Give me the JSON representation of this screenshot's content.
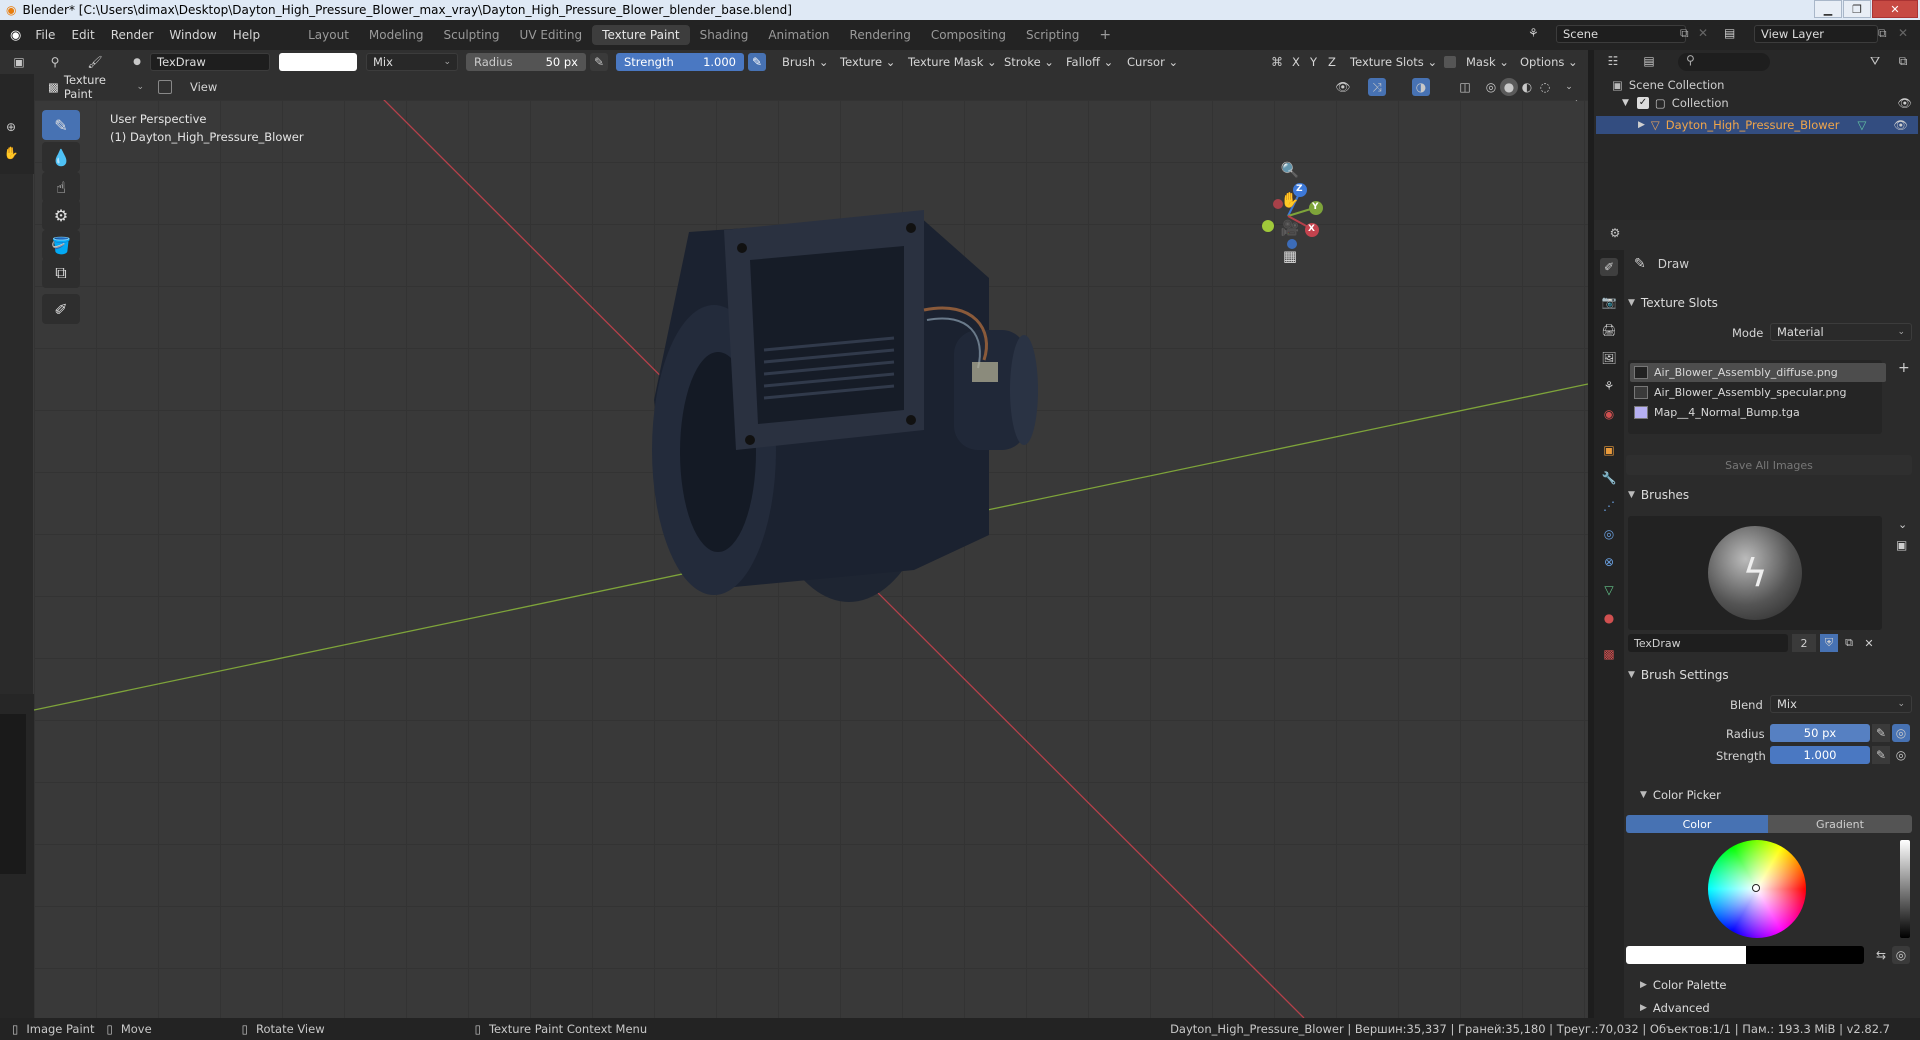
{
  "window": {
    "title": "Blender* [C:\\Users\\dimax\\Desktop\\Dayton_High_Pressure_Blower_max_vray\\Dayton_High_Pressure_Blower_blender_base.blend]"
  },
  "menu": [
    "File",
    "Edit",
    "Render",
    "Window",
    "Help"
  ],
  "workspaces": [
    "Layout",
    "Modeling",
    "Sculpting",
    "UV Editing",
    "Texture Paint",
    "Shading",
    "Animation",
    "Rendering",
    "Compositing",
    "Scripting"
  ],
  "active_workspace": "Texture Paint",
  "scene": {
    "name": "Scene",
    "view_layer": "View Layer"
  },
  "toolheader": {
    "brush_name": "TexDraw",
    "blend": "Mix",
    "radius_label": "Radius",
    "radius_value": "50 px",
    "strength_label": "Strength",
    "strength_value": "1.000",
    "menus": [
      "Brush",
      "Texture",
      "Texture Mask",
      "Stroke",
      "Falloff",
      "Cursor"
    ],
    "axes": [
      "X",
      "Y",
      "Z"
    ],
    "texture_slots": "Texture Slots",
    "mask": "Mask",
    "options": "Options"
  },
  "modeheader": {
    "mode": "Texture Paint",
    "view": "View"
  },
  "viewport": {
    "perspective": "User Perspective",
    "object": "(1) Dayton_High_Pressure_Blower",
    "gizmo": {
      "z": "Z",
      "y": "Y",
      "x": "X"
    }
  },
  "outliner": {
    "root": "Scene Collection",
    "collection": "Collection",
    "object": "Dayton_High_Pressure_Blower"
  },
  "properties": {
    "tool": "Draw",
    "texture_slots": {
      "title": "Texture Slots",
      "mode_label": "Mode",
      "mode_value": "Material",
      "slots": [
        "Air_Blower_Assembly_diffuse.png",
        "Air_Blower_Assembly_specular.png",
        "Map__4_Normal_Bump.tga"
      ],
      "save_all": "Save All Images"
    },
    "brushes": {
      "title": "Brushes",
      "name": "TexDraw",
      "users": "2"
    },
    "brush_settings": {
      "title": "Brush Settings",
      "blend_label": "Blend",
      "blend_value": "Mix",
      "radius_label": "Radius",
      "radius_value": "50 px",
      "strength_label": "Strength",
      "strength_value": "1.000"
    },
    "color_picker": {
      "title": "Color Picker",
      "tab_color": "Color",
      "tab_gradient": "Gradient"
    },
    "color_palette": "Color Palette",
    "advanced": "Advanced"
  },
  "statusbar": {
    "image_paint": "Image Paint",
    "move": "Move",
    "rotate": "Rotate View",
    "context": "Texture Paint Context Menu",
    "stats": "Dayton_High_Pressure_Blower | Вершин:35,337 | Граней:35,180 | Треуг.:70,032 | Объектов:1/1 | Пам.: 193.3 MiB | v2.82.7"
  },
  "colors": {
    "accent": "#4772b3",
    "x_axis": "#b5404a",
    "y_axis": "#7ea43a",
    "z_axis": "#3d79d8"
  }
}
